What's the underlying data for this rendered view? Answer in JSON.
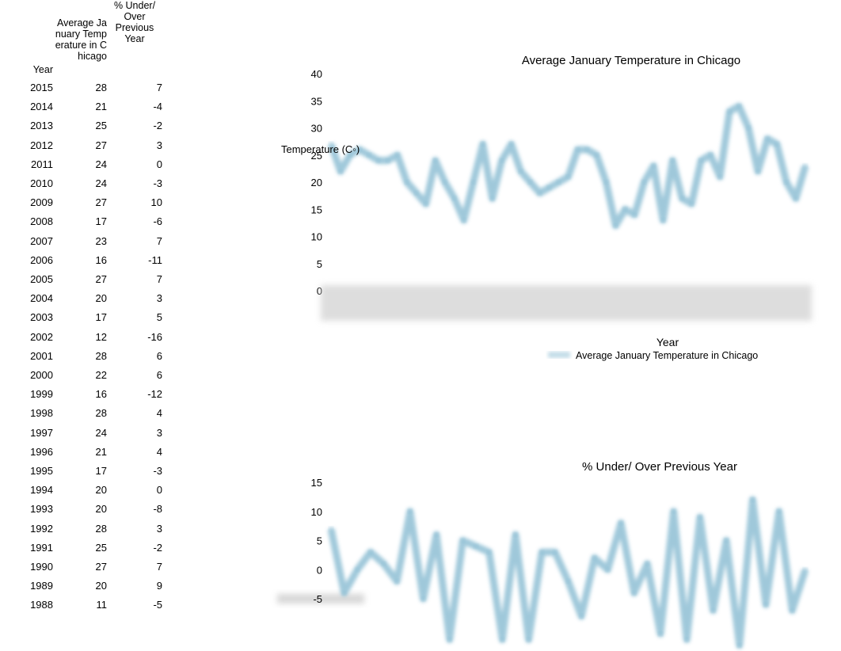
{
  "table": {
    "headers": {
      "year": "Year",
      "temp": "Average January Temperature in Chicago",
      "pct": "% Under/ Over Previous Year"
    },
    "rows": [
      [
        "2015",
        "28",
        "7"
      ],
      [
        "2014",
        "21",
        "-4"
      ],
      [
        "2013",
        "25",
        "-2"
      ],
      [
        "2012",
        "27",
        "3"
      ],
      [
        "2011",
        "24",
        "0"
      ],
      [
        "2010",
        "24",
        "-3"
      ],
      [
        "2009",
        "27",
        "10"
      ],
      [
        "2008",
        "17",
        "-6"
      ],
      [
        "2007",
        "23",
        "7"
      ],
      [
        "2006",
        "16",
        "-11"
      ],
      [
        "2005",
        "27",
        "7"
      ],
      [
        "2004",
        "20",
        "3"
      ],
      [
        "2003",
        "17",
        "5"
      ],
      [
        "2002",
        "12",
        "-16"
      ],
      [
        "2001",
        "28",
        "6"
      ],
      [
        "2000",
        "22",
        "6"
      ],
      [
        "1999",
        "16",
        "-12"
      ],
      [
        "1998",
        "28",
        "4"
      ],
      [
        "1997",
        "24",
        "3"
      ],
      [
        "1996",
        "21",
        "4"
      ],
      [
        "1995",
        "17",
        "-3"
      ],
      [
        "1994",
        "20",
        "0"
      ],
      [
        "1993",
        "20",
        "-8"
      ],
      [
        "1992",
        "28",
        "3"
      ],
      [
        "1991",
        "25",
        "-2"
      ],
      [
        "1990",
        "27",
        "7"
      ],
      [
        "1989",
        "20",
        "9"
      ],
      [
        "1988",
        "11",
        "-5"
      ]
    ]
  },
  "chart_data": [
    {
      "type": "line",
      "title": "Average January Temperature in Chicago",
      "xlabel": "Year",
      "ylabel": "Temperature (C◦)",
      "ylim": [
        0,
        40
      ],
      "yticks": [
        "40",
        "35",
        "30",
        "25",
        "20",
        "15",
        "10",
        "5",
        "0"
      ],
      "grid": true,
      "legend": {
        "position": "bottom",
        "entries": [
          "Average January Temperature in Chicago"
        ]
      },
      "series_color": "#8fbfd4",
      "values": [
        27,
        22,
        25,
        26,
        25,
        24,
        24,
        25,
        20,
        18,
        16,
        24,
        20,
        17,
        13,
        20,
        27,
        17,
        24,
        27,
        22,
        20,
        18,
        19,
        20,
        21,
        26,
        26,
        25,
        20,
        12,
        15,
        14,
        20,
        23,
        13,
        24,
        17,
        16,
        24,
        25,
        21,
        33,
        34,
        30,
        22,
        28,
        27,
        20,
        17,
        23
      ]
    },
    {
      "type": "line",
      "title": "% Under/ Over Previous Year",
      "ylim": [
        -12,
        15
      ],
      "yticks": [
        "15",
        "10",
        "5",
        "0",
        "-5"
      ],
      "grid": true,
      "series_color": "#8fbfd4",
      "values": [
        7,
        -4,
        0,
        3,
        1,
        -2,
        10,
        -5,
        6,
        -12,
        5,
        4,
        3,
        -12,
        6,
        -12,
        3,
        3,
        -2,
        -8,
        2,
        0,
        8,
        -4,
        1,
        -11,
        10,
        -12,
        9,
        -7,
        5,
        -13,
        12,
        -6,
        10,
        -7,
        0
      ]
    }
  ]
}
